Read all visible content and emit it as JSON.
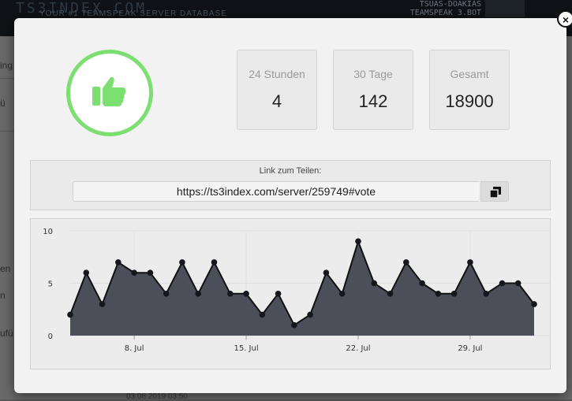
{
  "background": {
    "logo_text": "TS3INDEX.COM",
    "subtitle": "YOUR #1 TEAMSPEAK SERVER DATABASE",
    "banner_line1": "TSUAS-DOAKIAS",
    "banner_line2": "TEAMSPEAK 3.BOT",
    "side_texts": [
      "ing",
      "ü",
      "en",
      "n",
      "ufü"
    ],
    "bottom_text": "03.08.2019 03:50"
  },
  "modal": {
    "close_label": "×",
    "stats": [
      {
        "label": "24 Stunden",
        "value": "4"
      },
      {
        "label": "30 Tage",
        "value": "142"
      },
      {
        "label": "Gesamt",
        "value": "18900"
      }
    ],
    "share": {
      "label": "Link zum Teilen:",
      "url": "https://ts3index.com/server/259749#vote"
    }
  },
  "colors": {
    "accent_green": "#7ddf72",
    "area_fill": "#4c4f5a",
    "line_color": "#111111"
  },
  "icons": {
    "vote": "thumbs-up-icon",
    "copy": "copy-icon",
    "close": "close-icon"
  },
  "chart_data": {
    "type": "area",
    "title": "",
    "xlabel": "",
    "ylabel": "",
    "ylim": [
      0,
      10
    ],
    "yticks": [
      0,
      5,
      10
    ],
    "xtick_labels": [
      "8. Jul",
      "15. Jul",
      "22. Jul",
      "29. Jul"
    ],
    "grid": true,
    "series": [
      {
        "dates": [
          "2019-07-04",
          "2019-07-05",
          "2019-07-06",
          "2019-07-07",
          "2019-07-08",
          "2019-07-09",
          "2019-07-10",
          "2019-07-11",
          "2019-07-12",
          "2019-07-13",
          "2019-07-14",
          "2019-07-15",
          "2019-07-16",
          "2019-07-17",
          "2019-07-18",
          "2019-07-19",
          "2019-07-20",
          "2019-07-21",
          "2019-07-22",
          "2019-07-23",
          "2019-07-24",
          "2019-07-25",
          "2019-07-26",
          "2019-07-27",
          "2019-07-28",
          "2019-07-29",
          "2019-07-30",
          "2019-07-31",
          "2019-08-01",
          "2019-08-02"
        ],
        "values": [
          2,
          6,
          3,
          7,
          6,
          6,
          4,
          7,
          4,
          7,
          4,
          4,
          2,
          4,
          1,
          2,
          6,
          4,
          9,
          5,
          4,
          7,
          5,
          4,
          4,
          7,
          4,
          5,
          5,
          3
        ]
      }
    ]
  }
}
